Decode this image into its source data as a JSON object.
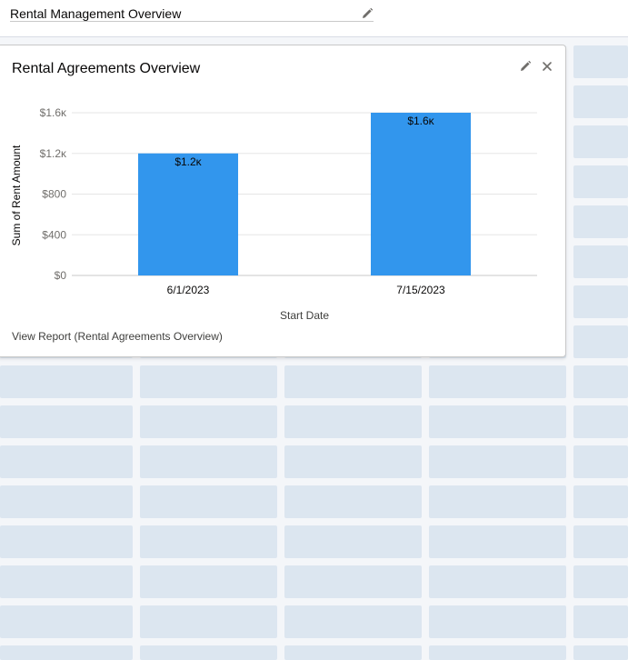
{
  "page": {
    "title": "Rental Management Overview"
  },
  "widget": {
    "title": "Rental Agreements Overview",
    "view_report_label": "View Report (Rental Agreements Overview)"
  },
  "icons": {
    "edit": "pencil-icon",
    "close": "close-icon"
  },
  "colors": {
    "bar": "#3296ed",
    "placeholder_cell": "#dce6f0",
    "background": "#f4f6f9"
  },
  "chart_data": {
    "type": "bar",
    "categories": [
      "6/1/2023",
      "7/15/2023"
    ],
    "values": [
      1200,
      1600
    ],
    "data_labels": [
      "$1.2ᴋ",
      "$1.6ᴋ"
    ],
    "yticks": [
      0,
      400,
      800,
      1200,
      1600
    ],
    "ytick_labels": [
      "$0",
      "$400",
      "$800",
      "$1.2ᴋ",
      "$1.6ᴋ"
    ],
    "ylim": [
      0,
      1600
    ],
    "xlabel": "Start Date",
    "ylabel": "Sum of Rent Amount",
    "grid": true
  }
}
